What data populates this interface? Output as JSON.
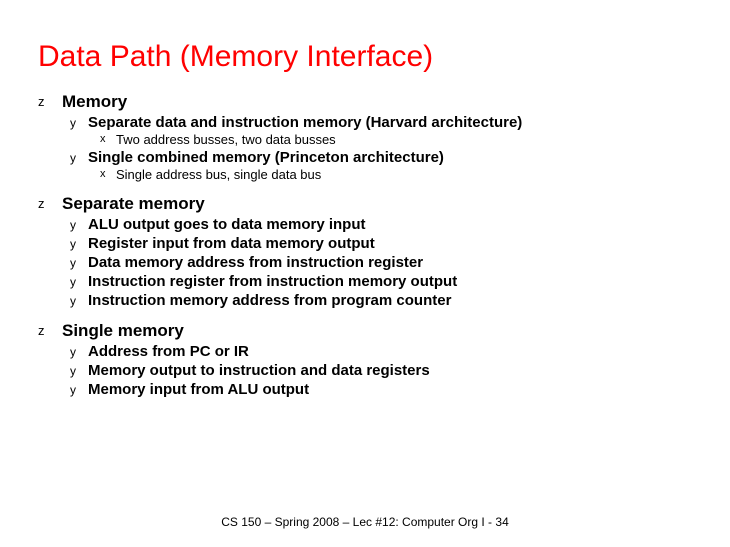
{
  "title": "Data Path (Memory Interface)",
  "sections": {
    "s0": {
      "heading": "Memory",
      "i0": "Separate data and instruction memory (Harvard architecture)",
      "i0d0": "Two address busses, two data busses",
      "i1": "Single combined memory (Princeton architecture)",
      "i1d0": "Single address bus, single data bus"
    },
    "s1": {
      "heading": "Separate memory",
      "i0": "ALU output goes to data memory input",
      "i1": "Register input from data memory output",
      "i2": "Data memory address from instruction register",
      "i3": "Instruction register from instruction memory output",
      "i4": "Instruction memory address from program counter"
    },
    "s2": {
      "heading": "Single memory",
      "i0": "Address from PC or IR",
      "i1": "Memory output to instruction and data registers",
      "i2": "Memory input from ALU output"
    }
  },
  "footer": "CS 150 – Spring 2008 – Lec #12: Computer Org I - 34"
}
